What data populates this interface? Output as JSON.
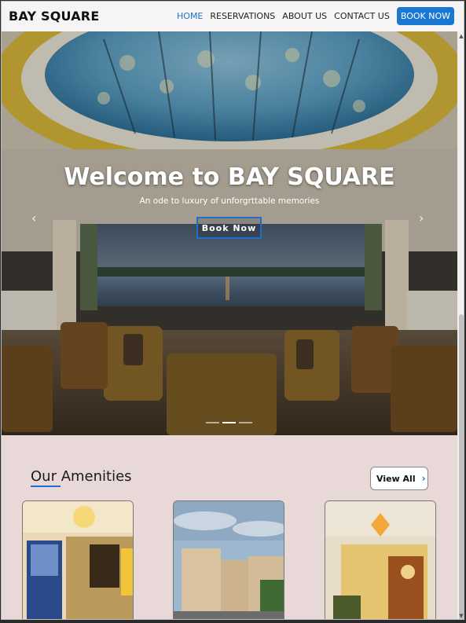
{
  "navbar": {
    "brand": "BAY SQUARE",
    "links": [
      "HOME",
      "RESERVATIONS",
      "ABOUT US",
      "CONTACT US"
    ],
    "book_button": "BOOK NOW"
  },
  "hero": {
    "title": "Welcome to BAY SQUARE",
    "subtitle": "An ode to luxury of unforgrttable memories",
    "button": "Book Now",
    "prev_arrow": "‹",
    "next_arrow": "›"
  },
  "amenities": {
    "title": "Our Amenities",
    "view_all": "View All",
    "view_all_chevron": "›"
  },
  "colors": {
    "accent": "#1a78d2",
    "page_bg": "#e8d8d8"
  }
}
